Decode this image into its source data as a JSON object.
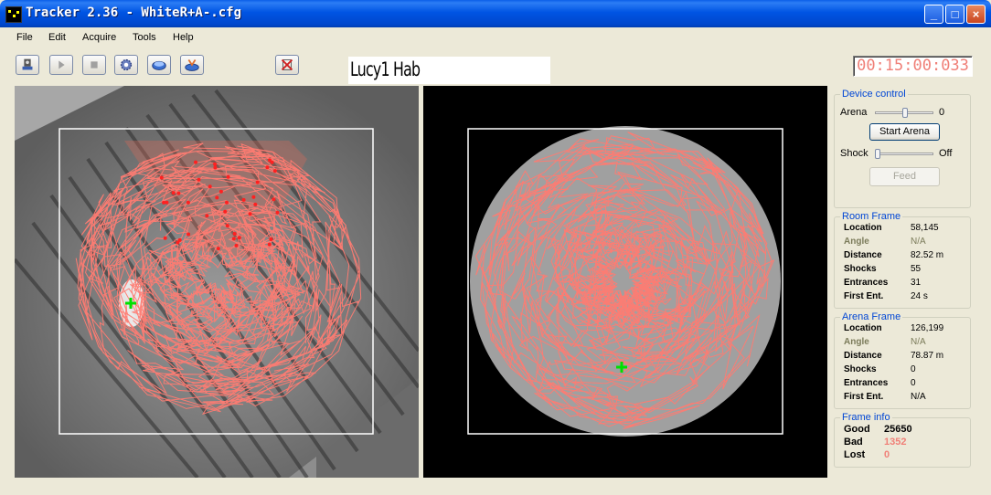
{
  "window": {
    "title": "Tracker 2.36 - WhiteR+A-.cfg",
    "buttons": {
      "minimize": "_",
      "maximize": "□",
      "close": "×"
    }
  },
  "menu": [
    "File",
    "Edit",
    "Acquire",
    "Tools",
    "Help"
  ],
  "toolbar": {
    "icons": [
      "camera-icon",
      "play-icon",
      "stop-icon",
      "settings-icon",
      "arena-icon",
      "shock-icon",
      "cancel-icon"
    ],
    "label_text": "Lucy1 Hab",
    "timer": "00:15:00:033"
  },
  "device_control": {
    "title": "Device control",
    "arena_label": "Arena",
    "arena_value": "0",
    "start_button": "Start Arena",
    "shock_label": "Shock",
    "shock_value": "Off",
    "feed_button": "Feed"
  },
  "room_frame": {
    "title": "Room Frame",
    "rows": [
      {
        "label": "Location",
        "value": "58,145"
      },
      {
        "label": "Angle",
        "value": "N/A"
      },
      {
        "label": "Distance",
        "value": "82.52 m"
      },
      {
        "label": "Shocks",
        "value": "55"
      },
      {
        "label": "Entrances",
        "value": "31"
      },
      {
        "label": "First Ent.",
        "value": "24 s"
      }
    ]
  },
  "arena_frame": {
    "title": "Arena Frame",
    "rows": [
      {
        "label": "Location",
        "value": "126,199"
      },
      {
        "label": "Angle",
        "value": "N/A"
      },
      {
        "label": "Distance",
        "value": "78.87 m"
      },
      {
        "label": "Shocks",
        "value": "0"
      },
      {
        "label": "Entrances",
        "value": "0"
      },
      {
        "label": "First Ent.",
        "value": "N/A"
      }
    ]
  },
  "frame_info": {
    "title": "Frame info",
    "good_label": "Good",
    "good_value": "25650",
    "bad_label": "Bad",
    "bad_value": "1352",
    "lost_label": "Lost",
    "lost_value": "0"
  },
  "colors": {
    "track": "#FF7B72",
    "marker": "#00E000",
    "shock_dot": "#FF2020",
    "timer_text": "#F08078",
    "group_title": "#0046D5"
  }
}
